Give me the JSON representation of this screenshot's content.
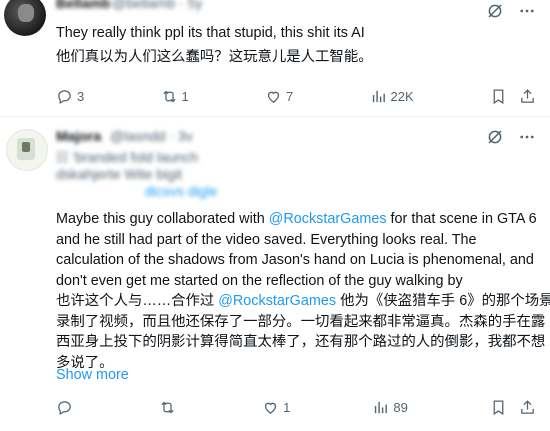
{
  "tweet1": {
    "author_blurred": "Bellamb",
    "handle_blurred": "@bellamb · 5y",
    "text_en": "They really think ppl its that stupid, this shit its AI",
    "text_zh": "他们真以为人们这么蠢吗？这玩意儿是人工智能。",
    "replies": "3",
    "reposts": "1",
    "likes": "7",
    "views": "22K"
  },
  "tweet2": {
    "author_blurred": "Majora",
    "handle_blurred": "@lasndd · 3v",
    "bio_blurred_1": "☷ 'branded fold launch",
    "bio_blurred_2": "dskahjerte   Wite bigit",
    "bio_blurred_3": "dicsvs digle",
    "text_en_lines": [
      [
        "Maybe this guy collaborated with ",
        "@RockstarGames",
        " for that scene in GTA 6"
      ],
      [
        "and he still had part of the video saved. Everything looks real. The"
      ],
      [
        "calculation of the shadows from Jason's hand on Lucia is phenomenal, and"
      ],
      [
        "don't even get me started on the reflection of the guy walking by"
      ]
    ],
    "text_zh_lines": [
      [
        "也许这个人与……合作过 ",
        "@RockstarGames",
        " 他为《侠盗猎车手 6》的那个场景"
      ],
      [
        "录制了视频，而且他还保存了一部分。一切看起来都非常逼真。杰森的手在露"
      ],
      [
        "西亚身上投下的阴影计算得简直太棒了，还有那个路过的人的倒影，我都不想"
      ],
      [
        "多说了。"
      ]
    ],
    "show_more": "Show more",
    "replies": "",
    "reposts": "",
    "likes": "1",
    "views": "89"
  },
  "colors": {
    "accent": "#1d9bf0",
    "muted": "#536471",
    "text": "#0f1419",
    "divider": "#eff3f4"
  },
  "icons": [
    "grok-icon",
    "more-icon",
    "reply-icon",
    "repost-icon",
    "like-icon",
    "views-icon",
    "bookmark-icon",
    "share-icon"
  ]
}
